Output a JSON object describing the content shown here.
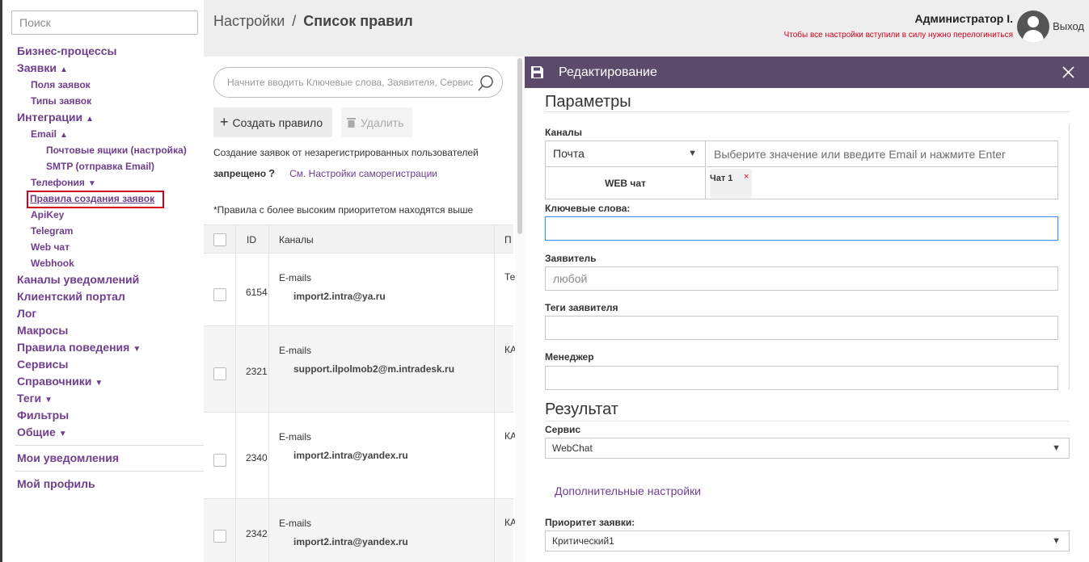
{
  "sidebar": {
    "search_placeholder": "Поиск",
    "items": {
      "business": "Бизнес-процессы",
      "requests": "Заявки",
      "request_fields": "Поля заявок",
      "request_types": "Типы заявок",
      "integrations": "Интеграции",
      "email": "Email",
      "mailboxes": "Почтовые ящики (настройка)",
      "smtp": "SMTP (отправка Email)",
      "telephony": "Телефония",
      "rules": "Правила создания заявок",
      "apikey": "ApiKey",
      "telegram": "Telegram",
      "webchat": "Web чат",
      "webhook": "Webhook",
      "notif_channels": "Каналы уведомлений",
      "client_portal": "Клиентский портал",
      "log": "Лог",
      "macros": "Макросы",
      "behavior": "Правила поведения",
      "services": "Сервисы",
      "directories": "Справочники",
      "tags": "Теги",
      "filters": "Фильтры",
      "general": "Общие",
      "my_notifications": "Мои уведомления",
      "my_profile": "Мой профиль"
    },
    "caret_up": "▲",
    "caret_down": "▼"
  },
  "header": {
    "crumb_root": "Настройки",
    "crumb_sep": "/",
    "crumb_current": "Список правил",
    "user_name": "Администратор I.",
    "warning": "Чтобы все настройки вступили в силу нужно перелогиниться",
    "logout": "Выход"
  },
  "list": {
    "search_placeholder": "Начните вводить Ключевые слова, Заявителя, Сервис",
    "create_label": "Создать правило",
    "delete_label": "Удалить",
    "info_line1": "Создание заявок от незарегистрированных пользователей",
    "info_forbidden": "запрещено",
    "info_q": "?",
    "info_link": "См. Настройки саморегистрации",
    "info_priority": "*Правила с более высоким приоритетом находятся выше",
    "columns": {
      "id": "ID",
      "channels": "Каналы",
      "more": "П"
    },
    "rows": [
      {
        "id": "6154",
        "label": "E-mails",
        "email": "import2.intra@ya.ru",
        "more": "Те"
      },
      {
        "id": "2321",
        "label": "E-mails",
        "email": "support.ilpolmob2@m.intradesk.ru",
        "more": "КА"
      },
      {
        "id": "2340",
        "label": "E-mails",
        "email": "import2.intra@yandex.ru",
        "more": "КА"
      },
      {
        "id": "2342",
        "label": "E-mails",
        "email": "import2.intra@yandex.ru",
        "more": "КА"
      }
    ]
  },
  "edit": {
    "title": "Редактирование",
    "params_title": "Параметры",
    "channels_label": "Каналы",
    "channel_type": "Почта",
    "channel_input_placeholder": "Выберите значение или введите Email и нажмите Enter",
    "web_chat_label": "WEB чат",
    "chat_tag": "Чат 1",
    "chat_tag_remove": "×",
    "keywords_label": "Ключевые слова:",
    "keywords_value": "",
    "applicant_label": "Заявитель",
    "applicant_placeholder": "любой",
    "applicant_tags_label": "Теги заявителя",
    "manager_label": "Менеджер",
    "result_title": "Результат",
    "service_label": "Сервис",
    "service_value": "WebChat",
    "more_settings": "Дополнительные настройки",
    "priority_label": "Приоритет заявки:",
    "priority_value": "Критический1",
    "arrow": "▼"
  }
}
